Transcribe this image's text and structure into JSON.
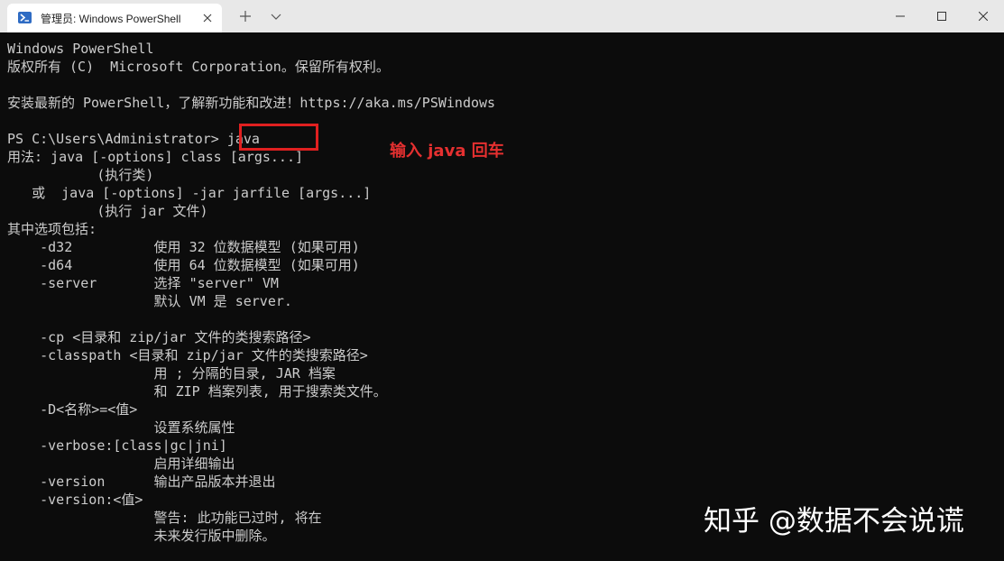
{
  "window": {
    "tab_title": "管理员: Windows PowerShell"
  },
  "terminal": {
    "lines": [
      "Windows PowerShell",
      "版权所有 (C)  Microsoft Corporation。保留所有权利。",
      "",
      "安装最新的 PowerShell，了解新功能和改进！https://aka.ms/PSWindows",
      "",
      "PS C:\\Users\\Administrator> java",
      "用法: java [-options] class [args...]",
      "           (执行类)",
      "   或  java [-options] -jar jarfile [args...]",
      "           (执行 jar 文件)",
      "其中选项包括:",
      "    -d32          使用 32 位数据模型 (如果可用)",
      "    -d64          使用 64 位数据模型 (如果可用)",
      "    -server       选择 \"server\" VM",
      "                  默认 VM 是 server.",
      "",
      "    -cp <目录和 zip/jar 文件的类搜索路径>",
      "    -classpath <目录和 zip/jar 文件的类搜索路径>",
      "                  用 ; 分隔的目录, JAR 档案",
      "                  和 ZIP 档案列表, 用于搜索类文件。",
      "    -D<名称>=<值>",
      "                  设置系统属性",
      "    -verbose:[class|gc|jni]",
      "                  启用详细输出",
      "    -version      输出产品版本并退出",
      "    -version:<值>",
      "                  警告: 此功能已过时, 将在",
      "                  未来发行版中删除。"
    ]
  },
  "annotation": {
    "text": "输入 java 回车",
    "color": "#e53030"
  },
  "watermark": {
    "text": "知乎 @数据不会说谎"
  },
  "colors": {
    "terminal_bg": "#0c0c0c",
    "terminal_fg": "#cccccc",
    "highlight_border": "#e02020"
  }
}
